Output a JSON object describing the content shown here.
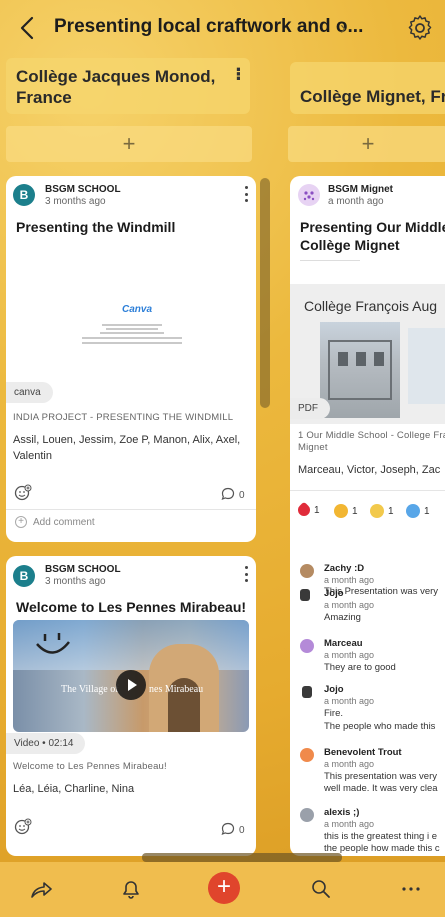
{
  "header": {
    "title": "Presenting local craftwork and o...",
    "chevron": "›"
  },
  "columns": [
    {
      "title": "Collège Jacques Monod, France"
    },
    {
      "title": "Collège Mignet, Fra"
    }
  ],
  "add_symbol": "+",
  "cards_col1": [
    {
      "avatar_letter": "B",
      "author": "BSGM SCHOOL",
      "when": "3 months ago",
      "title": "Presenting the Windmill",
      "preview_logo": "Canva",
      "tag": "canva",
      "caption": "INDIA PROJECT - PRESENTING THE WINDMILL",
      "names": "Assil, Louen, Jessim, Zoe P, Manon, Alix, Axel, Valentin",
      "comment_count": "0",
      "add_comment": "Add comment"
    },
    {
      "avatar_letter": "B",
      "author": "BSGM SCHOOL",
      "when": "3 months ago",
      "title": "Welcome to Les Pennes Mirabeau!",
      "overlay_left": "The Village of",
      "overlay_right": "nes Mirabeau",
      "tag": "Video • 02:14",
      "caption": "Welcome to Les Pennes Mirabeau!",
      "names": "Léa, Léia, Charline, Nina",
      "comment_count": "0"
    }
  ],
  "card_col2": {
    "author": "BSGM Mignet",
    "when": "a month ago",
    "title_line1": "Presenting Our Middle S",
    "title_line2": "Collège Mignet",
    "pdf_heading": "Collège François Aug",
    "tag": "PDF",
    "caption_line1": "1 Our Middle School - College Fra",
    "caption_line2": "Mignet",
    "names": "Marceau, Victor, Joseph, Zac",
    "reactions": [
      {
        "count": "1",
        "color": "#e02b3a"
      },
      {
        "count": "1",
        "color": "#f2b632"
      },
      {
        "count": "1",
        "color": "#f2c94c"
      },
      {
        "count": "1",
        "color": "#58a6e8"
      }
    ],
    "comments": [
      {
        "name": "Zachy :D",
        "when": "a month ago",
        "text": [
          "This Presentation was very"
        ],
        "color": "#b58b62"
      },
      {
        "name": "Jojo",
        "when": "a month ago",
        "text": [
          "Amazing"
        ],
        "color": "#3a3a3a"
      },
      {
        "name": "Marceau",
        "when": "a month ago",
        "text": [
          "They are to good"
        ],
        "color": "#b48ad8"
      },
      {
        "name": "Jojo",
        "when": "a month ago",
        "text": [
          "Fire.",
          "The people who made this"
        ],
        "color": "#3a3a3a"
      },
      {
        "name": "Benevolent Trout",
        "when": "a month ago",
        "text": [
          "This presentation was very",
          "well made. It was very clea"
        ],
        "color": "#f08a4b"
      },
      {
        "name": "alexis ;)",
        "when": "a month ago",
        "text": [
          "this is the greatest thing i e",
          "the people how made this c"
        ],
        "color": "#9aa0aa"
      }
    ]
  },
  "colors": {
    "accent": "#e0452c",
    "board_bg": "#ecb93e",
    "avatar_blue": "#1c7f8c"
  }
}
